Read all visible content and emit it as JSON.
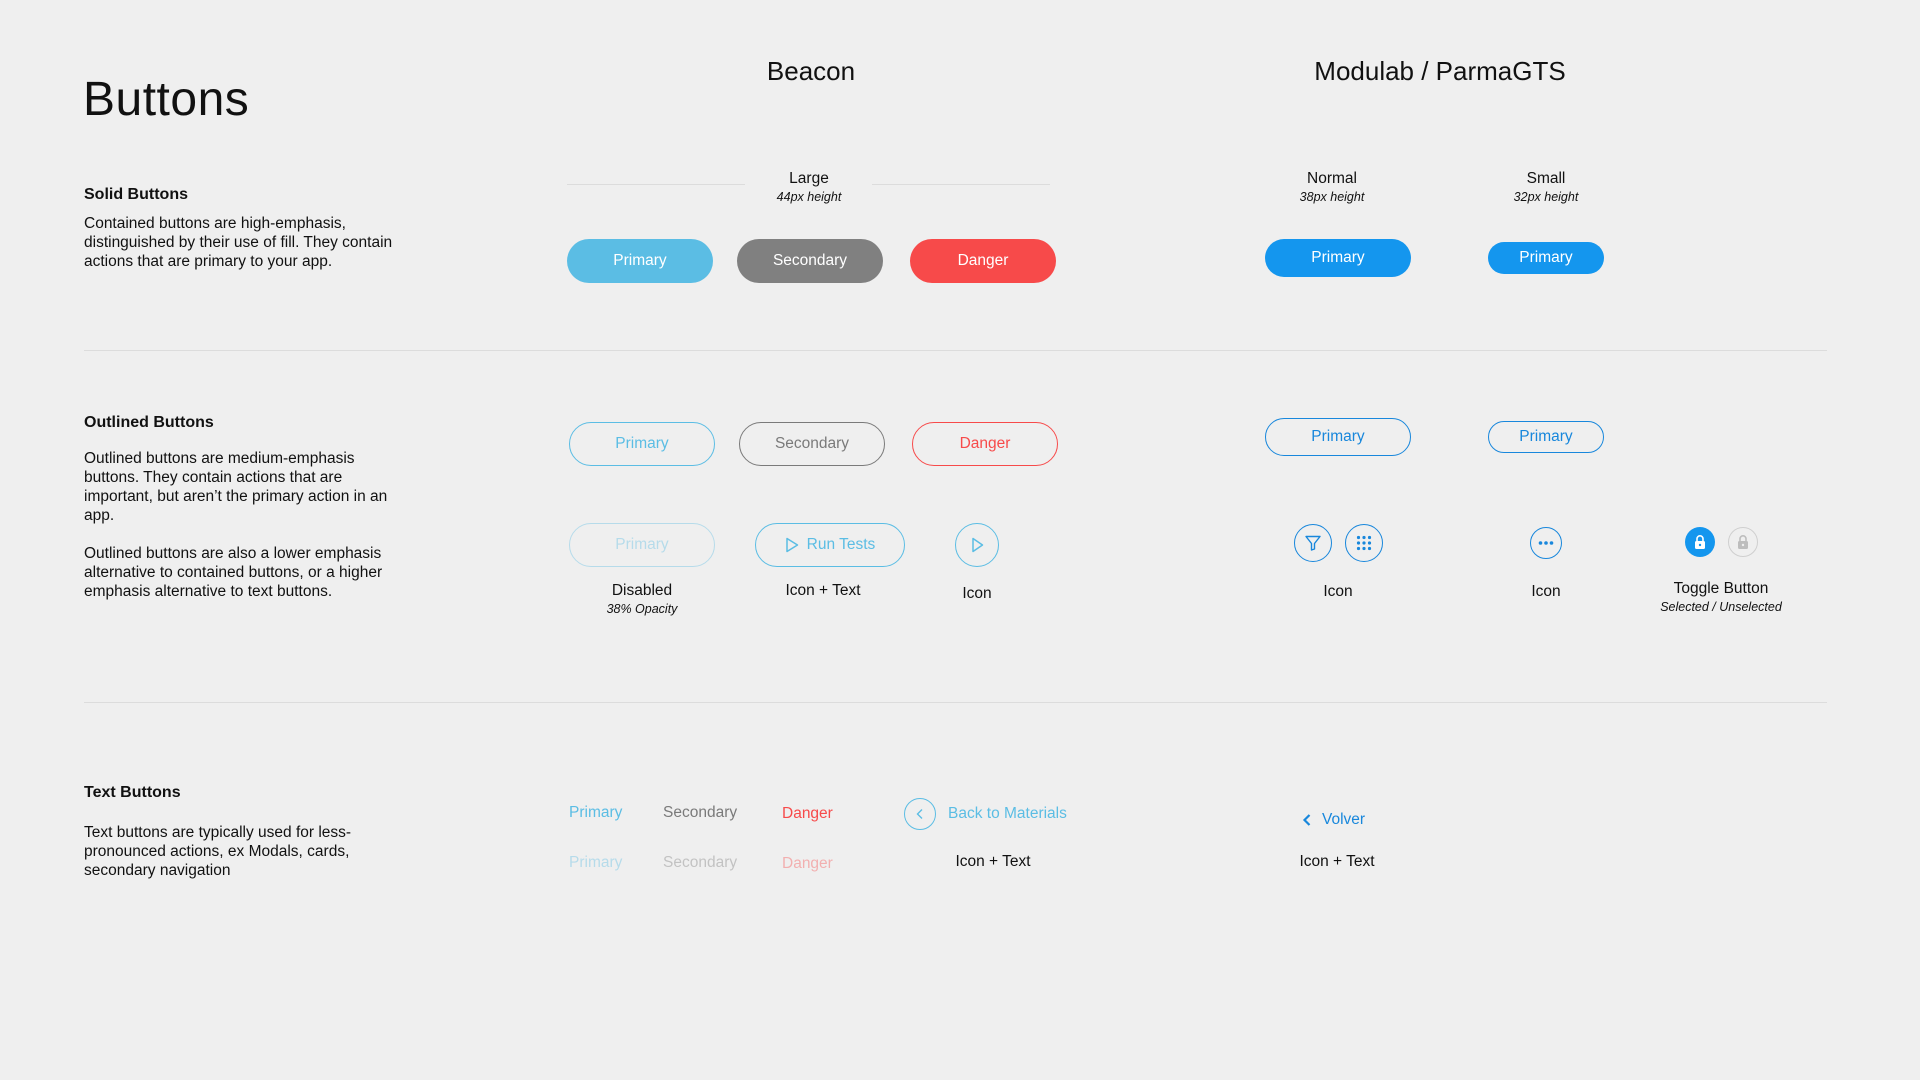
{
  "page": {
    "title": "Buttons"
  },
  "columns": {
    "beacon": "Beacon",
    "modulab": "Modulab / ParmaGTS"
  },
  "sizes": {
    "large": {
      "label": "Large",
      "sub": "44px height"
    },
    "normal": {
      "label": "Normal",
      "sub": "38px height"
    },
    "small": {
      "label": "Small",
      "sub": "32px height"
    }
  },
  "solid": {
    "title": "Solid  Buttons",
    "desc": "Contained buttons are high-emphasis, distinguished by their use of fill. They contain actions that are primary to your app.",
    "beacon": {
      "primary": "Primary",
      "secondary": "Secondary",
      "danger": "Danger"
    },
    "modu_normal": "Primary",
    "modu_small": "Primary"
  },
  "outlined": {
    "title": "Outlined Buttons",
    "desc1": "Outlined buttons are medium-emphasis buttons. They contain actions that are important, but aren’t the primary action in an app.",
    "desc2": "Outlined buttons are also a lower emphasis alternative to contained buttons, or a higher emphasis alternative to text buttons.",
    "beacon": {
      "primary": "Primary",
      "secondary": "Secondary",
      "danger": "Danger"
    },
    "disabled": {
      "label": "Primary",
      "caption": "Disabled",
      "sub": "38% Opacity"
    },
    "icon_text": {
      "label": "Run Tests",
      "caption": "Icon + Text"
    },
    "icon": {
      "caption": "Icon"
    },
    "modu_normal": "Primary",
    "modu_small": "Primary",
    "modu_icon_caption": "Icon",
    "modu_small_icon_caption": "Icon",
    "toggle": {
      "caption": "Toggle Button",
      "sub": "Selected / Unselected"
    }
  },
  "text": {
    "title": "Text Buttons",
    "desc": "Text buttons are typically used for less-pronounced actions, ex  Modals, cards, secondary navigation",
    "row1": {
      "primary": "Primary",
      "secondary": "Secondary",
      "danger": "Danger"
    },
    "row2": {
      "primary": "Primary",
      "secondary": "Secondary",
      "danger": "Danger"
    },
    "back": {
      "label": "Back to Materials",
      "caption": "Icon + Text"
    },
    "volver": {
      "label": "Volver",
      "caption": "Icon + Text"
    }
  },
  "colors": {
    "background": "#efefef",
    "beacon_primary": "#5bbde4",
    "beacon_secondary": "#808080",
    "beacon_danger": "#f74a4a",
    "modulab_primary": "#1496ee"
  }
}
